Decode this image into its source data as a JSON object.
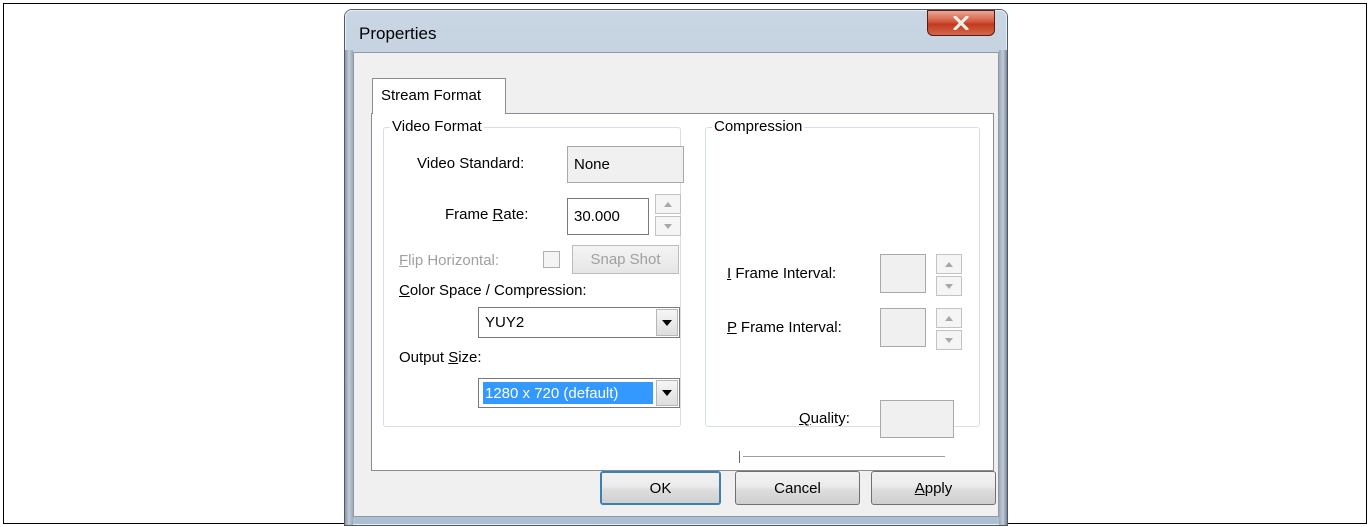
{
  "window": {
    "title": "Properties",
    "close_label": "x"
  },
  "tabs": [
    {
      "label": "Stream Format",
      "selected": true
    }
  ],
  "video_format": {
    "group_label": "Video Format",
    "video_standard_label": "Video Standard:",
    "video_standard_value": "None",
    "frame_rate_label_pre": "Frame ",
    "frame_rate_label_accel": "R",
    "frame_rate_label_post": "ate:",
    "frame_rate_value": "30.000",
    "flip_horizontal_label_accel": "F",
    "flip_horizontal_label_post": "lip Horizontal:",
    "snap_shot_label": "Snap Shot",
    "color_space_label_accel": "C",
    "color_space_label_post": "olor Space / Compression:",
    "color_space_value": "YUY2",
    "output_size_label_pre": "Output ",
    "output_size_label_accel": "S",
    "output_size_label_post": "ize:",
    "output_size_value": "1280 x 720  (default)"
  },
  "compression": {
    "group_label": "Compression",
    "i_frame_label_accel": "I",
    "i_frame_label_post": " Frame Interval:",
    "i_frame_value": "",
    "p_frame_label_accel": "P",
    "p_frame_label_post": " Frame Interval:",
    "p_frame_value": "",
    "quality_label_accel": "Q",
    "quality_label_post": "uality:",
    "quality_value": "",
    "quality_slider_fraction": 0
  },
  "buttons": {
    "ok": "OK",
    "cancel": "Cancel",
    "apply_accel": "A",
    "apply_post": "pply"
  },
  "colors": {
    "selection": "#3399ff",
    "close_button": "#c8452a",
    "disabled_text": "#a0a0a0"
  }
}
